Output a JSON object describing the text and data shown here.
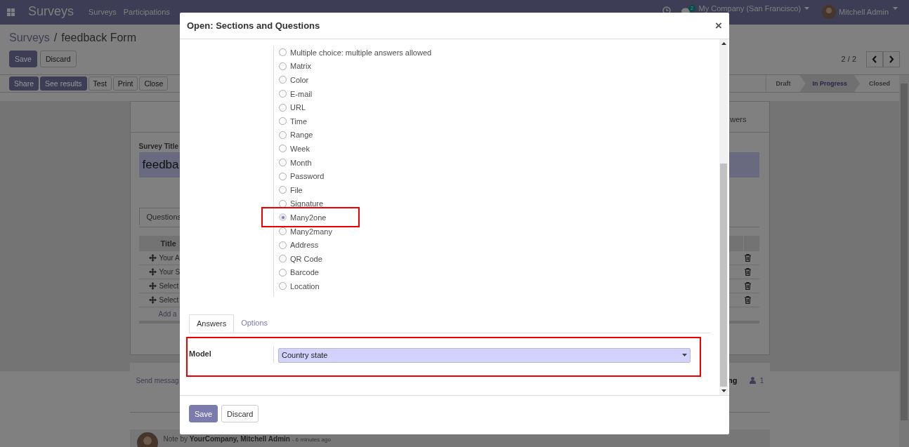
{
  "navbar": {
    "app_name": "Surveys",
    "menus": [
      "Surveys",
      "Participations"
    ],
    "chat_count": "2",
    "company": "My Company (San Francisco)",
    "user": "Mitchell Admin"
  },
  "breadcrumb": {
    "parent": "Surveys",
    "separator": "/",
    "current": "feedback Form"
  },
  "form_buttons": [
    {
      "label": "Save",
      "primary": true
    },
    {
      "label": "Discard",
      "primary": false
    }
  ],
  "pager": "2 / 2",
  "header_buttons": [
    {
      "label": "Share",
      "primary": true
    },
    {
      "label": "See results",
      "primary": true
    },
    {
      "label": "Test",
      "primary": false
    },
    {
      "label": "Print",
      "primary": false
    },
    {
      "label": "Close",
      "primary": false
    }
  ],
  "stages": [
    {
      "label": "Draft",
      "selected": false
    },
    {
      "label": "In Progress",
      "selected": true
    },
    {
      "label": "Closed",
      "selected": false
    }
  ],
  "sheet": {
    "button_box_text": "wers",
    "title_label": "Survey Title",
    "title_value": "feedba",
    "tab": "Questions",
    "column": "Title",
    "rows": [
      "Your A",
      "Your S",
      "Select",
      "Select"
    ],
    "add_line": "Add a"
  },
  "chatter": {
    "send_message": "Send messag",
    "follow": "ng",
    "followers": "1",
    "note": {
      "prefix": "Note by",
      "author": "YourCompany, Mitchell Admin",
      "time": "- 6 minutes ago"
    }
  },
  "dialog": {
    "title": "Open: Sections and Questions",
    "close": "×",
    "question_types": [
      {
        "label": "Multiple choice: multiple answers allowed",
        "selected": false
      },
      {
        "label": "Matrix",
        "selected": false
      },
      {
        "label": "Color",
        "selected": false
      },
      {
        "label": "E-mail",
        "selected": false
      },
      {
        "label": "URL",
        "selected": false
      },
      {
        "label": "Time",
        "selected": false
      },
      {
        "label": "Range",
        "selected": false
      },
      {
        "label": "Week",
        "selected": false
      },
      {
        "label": "Month",
        "selected": false
      },
      {
        "label": "Password",
        "selected": false
      },
      {
        "label": "File",
        "selected": false
      },
      {
        "label": "Signature",
        "selected": false
      },
      {
        "label": "Many2one",
        "selected": true
      },
      {
        "label": "Many2many",
        "selected": false
      },
      {
        "label": "Address",
        "selected": false
      },
      {
        "label": "QR Code",
        "selected": false
      },
      {
        "label": "Barcode",
        "selected": false
      },
      {
        "label": "Location",
        "selected": false
      }
    ],
    "tabs": [
      {
        "label": "Answers",
        "selected": true
      },
      {
        "label": "Options",
        "selected": false
      }
    ],
    "model_label": "Model",
    "model_value": "Country state",
    "buttons": [
      {
        "label": "Save",
        "primary": true
      },
      {
        "label": "Discard",
        "primary": false
      }
    ]
  }
}
